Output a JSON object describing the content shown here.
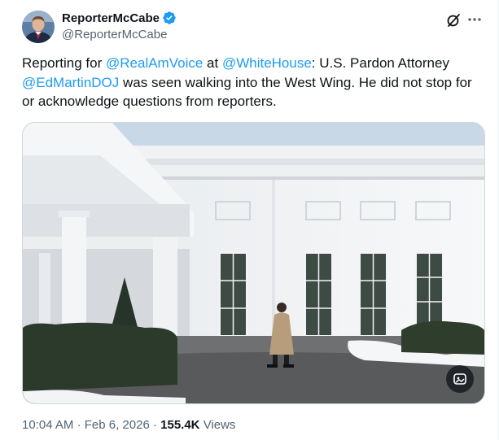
{
  "author": {
    "display_name": "ReporterMcCabe",
    "handle": "@ReporterMcCabe",
    "verified": true,
    "avatar_icon": "profile-photo"
  },
  "actions": {
    "grok_icon": "grok-icon",
    "more_icon": "more-horizontal-icon"
  },
  "tweet": {
    "text_1": "Reporting for ",
    "mention_1": "@RealAmVoice",
    "text_2": " at ",
    "mention_2": "@WhiteHouse",
    "text_3": ": U.S. Pardon Attorney ",
    "mention_3": "@EdMartinDOJ",
    "text_4": " was seen walking into the West Wing. He did not stop for or acknowledge questions from reporters."
  },
  "media": {
    "alt_icon": "image-description-icon"
  },
  "meta": {
    "time": "10:04 AM",
    "separator": "·",
    "date": "Feb 6, 2026",
    "views_count": "155.4K",
    "views_label": "Views"
  },
  "colors": {
    "link": "#1d9bf0",
    "secondary_text": "#536471",
    "verified_badge": "#1d9bf0"
  }
}
